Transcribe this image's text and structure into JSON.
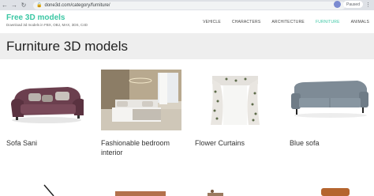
{
  "browser": {
    "url": "done3d.com/category/furniture/",
    "profile_label": "Paused"
  },
  "site": {
    "logo": "Free 3D models",
    "tagline": "Download 3d models in FBX, OBJ, MAX, 3DS, C4D",
    "nav": [
      "VEHICLE",
      "CHARACTERS",
      "ARCHITECTURE",
      "FURNITURE",
      "ANIMALS"
    ]
  },
  "page": {
    "title": "Furniture 3D models"
  },
  "products": [
    {
      "name": "Sofa Sani"
    },
    {
      "name": "Fashionable bedroom interior"
    },
    {
      "name": "Flower Curtains"
    },
    {
      "name": "Blue sofa"
    }
  ],
  "icons": [
    "back-icon",
    "forward-icon",
    "reload-icon",
    "lock-icon",
    "menu-dots-icon"
  ],
  "colors": {
    "brand": "#3cc7a4",
    "title_band": "#eeeeee"
  }
}
